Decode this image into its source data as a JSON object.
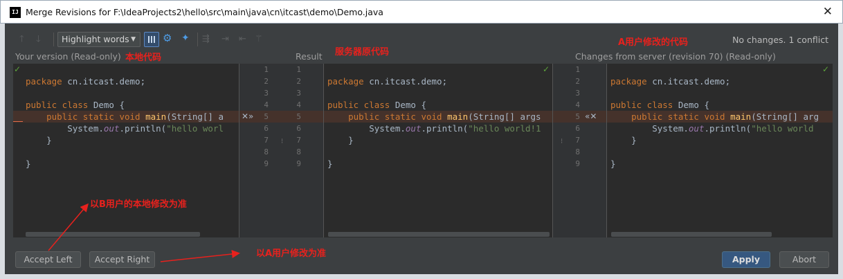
{
  "window": {
    "title": "Merge Revisions for F:\\IdeaProjects2\\hello\\src\\main\\java\\cn\\itcast\\demo\\Demo.java",
    "app_icon": "IJ",
    "close_icon": "✕"
  },
  "toolbar": {
    "up_arrow": "🡑",
    "down_arrow": "🡓",
    "highlight_label": "Highlight words",
    "status": "No changes. 1 conflict"
  },
  "labels": {
    "left": "Your version (Read-only)",
    "center": "Result",
    "right": "Changes from server (revision 70) (Read-only)"
  },
  "annotations": {
    "left_header": "本地代码",
    "center_header": "服务器原代码",
    "right_header": "A用户修改的代码",
    "accept_left_note": "以B用户的本地修改为准",
    "accept_right_note": "以A用户修改为准"
  },
  "markers": {
    "left_accept": "✕»",
    "right_accept": "«✕",
    "check": "✓"
  },
  "line_numbers": [
    "1",
    "2",
    "3",
    "4",
    "5",
    "6",
    "7",
    "8",
    "9"
  ],
  "code": {
    "left": {
      "l1_kw": "package",
      "l1_rest": " cn.itcast.demo;",
      "l3_kw": "public class",
      "l3_rest": " Demo {",
      "l4_pre": "    ",
      "l4_kw": "public static void",
      "l4_fn": " main",
      "l4_rest": "(String[] a",
      "l5_pre": "        System.",
      "l5_fld": "out",
      "l5_mid": ".println(",
      "l5_str": "\"hello worl",
      "l6": "    }",
      "l8": "}"
    },
    "center": {
      "l1_kw": "package",
      "l1_rest": " cn.itcast.demo;",
      "l3_kw": "public class",
      "l3_rest": " Demo {",
      "l4_pre": "    ",
      "l4_kw": "public static void",
      "l4_fn": " main",
      "l4_rest": "(String[] args",
      "l5_pre": "        System.",
      "l5_fld": "out",
      "l5_mid": ".println(",
      "l5_str": "\"hello world!1",
      "l6": "    }",
      "l8": "}"
    },
    "right": {
      "l1_kw": "package",
      "l1_rest": " cn.itcast.demo;",
      "l3_kw": "public class",
      "l3_rest": " Demo {",
      "l4_pre": "    ",
      "l4_kw": "public static void",
      "l4_fn": " main",
      "l4_rest": "(String[] arg",
      "l5_pre": "        System.",
      "l5_fld": "out",
      "l5_mid": ".println(",
      "l5_str": "\"hello world",
      "l6": "    }",
      "l8": "}"
    }
  },
  "buttons": {
    "accept_left": "Accept Left",
    "accept_right": "Accept Right",
    "apply": "Apply",
    "abort": "Abort"
  },
  "colors": {
    "accent": "#365880",
    "annotation": "#e8211d",
    "conflict_bg": "#45322b"
  }
}
